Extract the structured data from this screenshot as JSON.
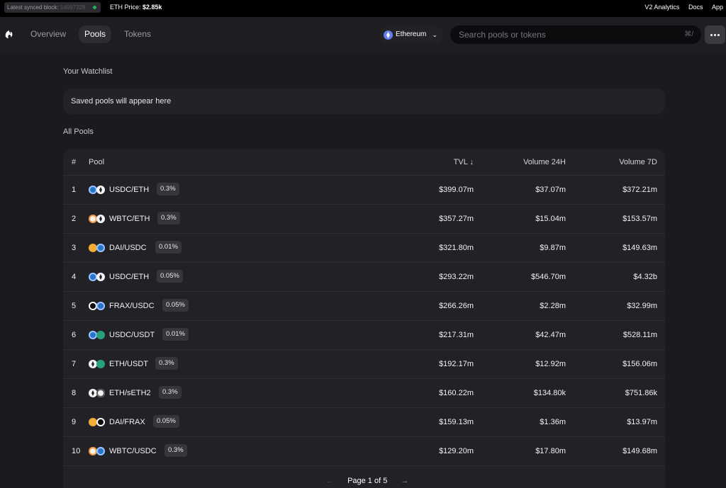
{
  "topbar": {
    "block_label": "Latest synced block:",
    "block_number": "14697328",
    "eth_price_label": "ETH Price:",
    "eth_price_value": "$2.85k",
    "links": [
      "V2 Analytics",
      "Docs",
      "App"
    ]
  },
  "nav": {
    "tabs": [
      {
        "label": "Overview",
        "active": false
      },
      {
        "label": "Pools",
        "active": true
      },
      {
        "label": "Tokens",
        "active": false
      }
    ],
    "network": "Ethereum",
    "search_placeholder": "Search pools or tokens",
    "search_shortcut": "⌘/"
  },
  "watchlist": {
    "title": "Your Watchlist",
    "empty_text": "Saved pools will appear here"
  },
  "pools": {
    "title": "All Pools",
    "columns": {
      "index": "#",
      "pool": "Pool",
      "tvl": "TVL ↓",
      "vol24": "Volume 24H",
      "vol7": "Volume 7D"
    },
    "rows": [
      {
        "idx": "1",
        "tokens": [
          "usdc",
          "eth"
        ],
        "pair": "USDC/ETH",
        "fee": "0.3%",
        "tvl": "$399.07m",
        "vol24": "$37.07m",
        "vol7": "$372.21m"
      },
      {
        "idx": "2",
        "tokens": [
          "wbtc",
          "eth"
        ],
        "pair": "WBTC/ETH",
        "fee": "0.3%",
        "tvl": "$357.27m",
        "vol24": "$15.04m",
        "vol7": "$153.57m"
      },
      {
        "idx": "3",
        "tokens": [
          "dai",
          "usdc"
        ],
        "pair": "DAI/USDC",
        "fee": "0.01%",
        "tvl": "$321.80m",
        "vol24": "$9.87m",
        "vol7": "$149.63m"
      },
      {
        "idx": "4",
        "tokens": [
          "usdc",
          "eth"
        ],
        "pair": "USDC/ETH",
        "fee": "0.05%",
        "tvl": "$293.22m",
        "vol24": "$546.70m",
        "vol7": "$4.32b"
      },
      {
        "idx": "5",
        "tokens": [
          "frax",
          "usdc"
        ],
        "pair": "FRAX/USDC",
        "fee": "0.05%",
        "tvl": "$266.26m",
        "vol24": "$2.28m",
        "vol7": "$32.99m"
      },
      {
        "idx": "6",
        "tokens": [
          "usdc",
          "usdt"
        ],
        "pair": "USDC/USDT",
        "fee": "0.01%",
        "tvl": "$217.31m",
        "vol24": "$42.47m",
        "vol7": "$528.11m"
      },
      {
        "idx": "7",
        "tokens": [
          "eth",
          "usdt"
        ],
        "pair": "ETH/USDT",
        "fee": "0.3%",
        "tvl": "$192.17m",
        "vol24": "$12.92m",
        "vol7": "$156.06m"
      },
      {
        "idx": "8",
        "tokens": [
          "eth",
          "seth2"
        ],
        "pair": "ETH/sETH2",
        "fee": "0.3%",
        "tvl": "$160.22m",
        "vol24": "$134.80k",
        "vol7": "$751.86k"
      },
      {
        "idx": "9",
        "tokens": [
          "dai",
          "frax"
        ],
        "pair": "DAI/FRAX",
        "fee": "0.05%",
        "tvl": "$159.13m",
        "vol24": "$1.36m",
        "vol7": "$13.97m"
      },
      {
        "idx": "10",
        "tokens": [
          "wbtc",
          "usdc"
        ],
        "pair": "WBTC/USDC",
        "fee": "0.3%",
        "tvl": "$129.20m",
        "vol24": "$17.80m",
        "vol7": "$149.68m"
      }
    ],
    "pagination": {
      "prev": "←",
      "label": "Page 1 of 5",
      "next": "→"
    }
  }
}
